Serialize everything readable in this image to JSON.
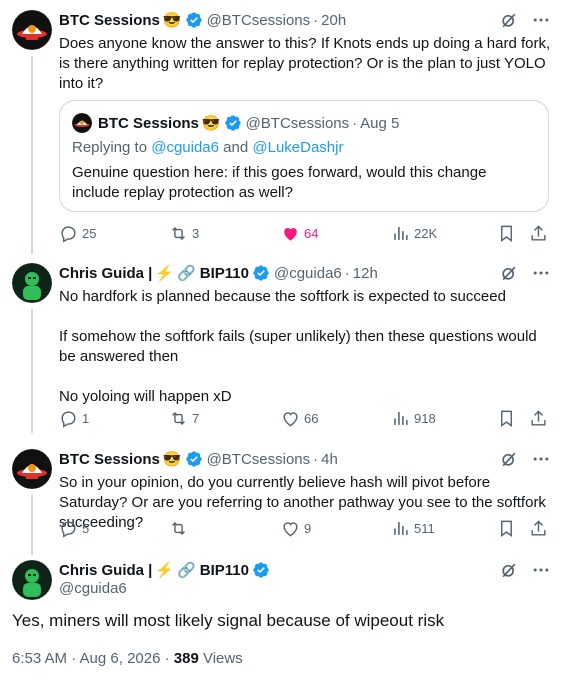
{
  "tweets": [
    {
      "name": "BTC Sessions",
      "emoji": "😎",
      "handle": "@BTCsessions",
      "time": "20h",
      "text": "Does anyone know the answer to this? If Knots ends up doing a hard fork, is there anything written for replay protection? Or is the plan to just YOLO into it?",
      "quote": {
        "name": "BTC Sessions",
        "emoji": "😎",
        "handle": "@BTCsessions",
        "time": "Aug 5",
        "replying_prefix": "Replying to",
        "replying_user1": "@cguida6",
        "replying_and": "and",
        "replying_user2": "@LukeDashjr",
        "text": "Genuine question here: if this goes forward, would this change include replay protection as well?"
      },
      "replies": "25",
      "reposts": "3",
      "likes": "64",
      "views": "22K"
    },
    {
      "name": "Chris Guida |",
      "emoji_bolt": "⚡",
      "emoji_chain": "🔗",
      "tag": "BIP110",
      "handle": "@cguida6",
      "time": "12h",
      "text1": "No hardfork is planned because the softfork is expected to succeed",
      "text2": "If somehow the softfork fails (super unlikely) then these questions would be answered then",
      "text3": "No yoloing will happen xD",
      "replies": "1",
      "reposts": "7",
      "likes": "66",
      "views": "918"
    },
    {
      "name": "BTC Sessions",
      "emoji": "😎",
      "handle": "@BTCsessions",
      "time": "4h",
      "text": "So in your opinion, do you currently believe hash will pivot before Saturday? Or are you referring to another pathway you see to the softfork succeeding?",
      "replies": "5",
      "reposts": "",
      "likes": "9",
      "views": "511"
    }
  ],
  "main": {
    "name": "Chris Guida |",
    "emoji_bolt": "⚡",
    "emoji_chain": "🔗",
    "tag": "BIP110",
    "handle": "@cguida6",
    "text": "Yes, miners will most likely signal because of wipeout risk",
    "timestamp": "6:53 AM · Aug 6, 2026 · ",
    "views_count": "389",
    "views_label": "Views"
  },
  "separator": "·",
  "colors": {
    "accent": "#1d9bf0",
    "like": "#f91880",
    "muted": "#536471",
    "border": "#cfd9de"
  },
  "icons": {
    "grok": "grok-icon",
    "more": "more-icon",
    "reply": "reply-icon",
    "repost": "repost-icon",
    "like": "heart-icon",
    "views": "views-icon",
    "bookmark": "bookmark-icon",
    "share": "share-icon"
  }
}
